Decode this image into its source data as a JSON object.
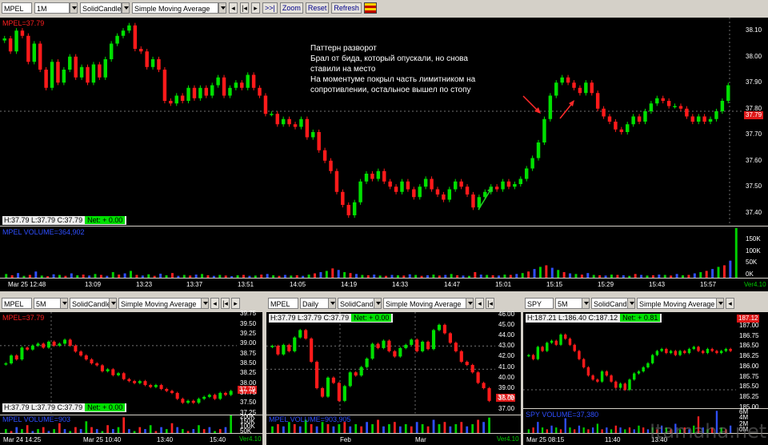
{
  "main": {
    "toolbar": {
      "symbol": "MPEL",
      "interval": "1M",
      "chart_style": "SolidCandle",
      "study": "Simple Moving Average",
      "zoom": "Zoom",
      "reset": "Reset",
      "refresh": "Refresh",
      "nav_left": "◂",
      "nav_home": "|◂",
      "nav_right": "▸",
      "nav_end": ">>|"
    },
    "price_label": "MPEL=37.79",
    "price_tag": "37.79",
    "ohlc": "H:37.79  L:37.79  C:37.79",
    "net": "Net: + 0.00",
    "volume_label": "MPEL VOLUME=364,902",
    "version": "Ver4.10",
    "y_ticks": [
      "38.10",
      "38.00",
      "37.90",
      "37.80",
      "37.70",
      "37.60",
      "37.50",
      "37.40"
    ],
    "vol_ticks": [
      "150K",
      "100K",
      "50K",
      "0K"
    ],
    "x_ticks": [
      "Mar 25 12:48",
      "13:09",
      "13:23",
      "13:37",
      "13:51",
      "14:05",
      "14:19",
      "14:33",
      "14:47",
      "15:01",
      "15:15",
      "15:29",
      "15:43",
      "15:57"
    ],
    "annotation": [
      "Паттерн разворот",
      "Брал от бида, который опускали, но снова",
      "ставили на место",
      "На моментуме покрыл часть лимитником на",
      "сопротивлении, остальное вышел по стопу"
    ]
  },
  "chart_data": [
    {
      "type": "candlestick",
      "name": "MPEL 1M",
      "ylim": [
        37.35,
        38.15
      ],
      "ticks": [
        38.1,
        38.0,
        37.9,
        37.8,
        37.7,
        37.6,
        37.5,
        37.4
      ],
      "closes": [
        38.07,
        38.02,
        38.1,
        38.08,
        37.98,
        38.05,
        37.95,
        37.88,
        37.98,
        37.9,
        37.95,
        38.0,
        37.92,
        37.96,
        37.9,
        37.97,
        37.92,
        37.99,
        38.05,
        38.08,
        38.1,
        38.12,
        38.03,
        38.02,
        37.96,
        37.99,
        37.95,
        37.83,
        37.82,
        37.85,
        37.83,
        37.88,
        37.84,
        37.88,
        37.85,
        37.89,
        37.92,
        37.85,
        37.88,
        37.9,
        37.88,
        37.93,
        37.88,
        37.85,
        37.78,
        37.78,
        37.74,
        37.76,
        37.74,
        37.73,
        37.76,
        37.69,
        37.71,
        37.64,
        37.6,
        37.56,
        37.48,
        37.43,
        37.39,
        37.44,
        37.52,
        37.55,
        37.53,
        37.56,
        37.52,
        37.5,
        37.48,
        37.52,
        37.49,
        37.46,
        37.5,
        37.53,
        37.49,
        37.47,
        37.45,
        37.49,
        37.52,
        37.5,
        37.47,
        37.42,
        37.46,
        37.48,
        37.5,
        37.49,
        37.52,
        37.5,
        37.51,
        37.53,
        37.57,
        37.61,
        37.67,
        37.76,
        37.85,
        37.9,
        37.92,
        37.9,
        37.88,
        37.86,
        37.9,
        37.86,
        37.8,
        37.77,
        37.75,
        37.72,
        37.71,
        37.74,
        37.77,
        37.75,
        37.79,
        37.82,
        37.84,
        37.83,
        37.81,
        37.81,
        37.8,
        37.77,
        37.75,
        37.77,
        37.75,
        37.76,
        37.79,
        37.83,
        37.89
      ],
      "volume": [
        12,
        8,
        15,
        6,
        9,
        20,
        7,
        5,
        11,
        9,
        6,
        14,
        8,
        10,
        7,
        12,
        9,
        6,
        18,
        10,
        14,
        22,
        9,
        7,
        11,
        6,
        13,
        8,
        15,
        6,
        9,
        7,
        10,
        12,
        8,
        6,
        9,
        7,
        5,
        8,
        9,
        6,
        7,
        10,
        12,
        8,
        6,
        9,
        7,
        8,
        6,
        10,
        14,
        18,
        22,
        30,
        25,
        18,
        15,
        12,
        9,
        8,
        10,
        7,
        6,
        9,
        8,
        7,
        11,
        9,
        6,
        8,
        10,
        7,
        9,
        12,
        8,
        7,
        6,
        18,
        10,
        9,
        8,
        7,
        10,
        9,
        12,
        15,
        20,
        28,
        35,
        40,
        32,
        25,
        18,
        14,
        12,
        10,
        15,
        9,
        8,
        7,
        10,
        9,
        8,
        6,
        12,
        9,
        7,
        8,
        10,
        9,
        7,
        12,
        8,
        9,
        14,
        18,
        22,
        28,
        35,
        40,
        55,
        160
      ]
    },
    {
      "type": "candlestick",
      "name": "MPEL 5M",
      "ylim": [
        37.2,
        39.8
      ],
      "ticks": [
        39.75,
        39.5,
        39.25,
        39.0,
        38.75,
        38.5,
        38.25,
        38.0,
        37.75,
        37.5,
        37.25
      ],
      "closes": [
        38.5,
        38.7,
        38.6,
        38.9,
        38.85,
        38.95,
        39.0,
        38.9,
        39.05,
        38.95,
        39.0,
        39.1,
        38.95,
        38.8,
        38.7,
        38.6,
        38.5,
        38.45,
        38.3,
        38.35,
        38.2,
        38.25,
        38.1,
        38.05,
        38.0,
        38.05,
        37.95,
        37.9,
        37.95,
        37.85,
        37.8,
        37.75,
        37.6,
        37.5,
        37.55,
        37.5,
        37.6,
        37.65,
        37.7,
        37.6,
        37.75,
        37.7,
        37.8
      ]
    },
    {
      "type": "candlestick",
      "name": "MPEL Daily",
      "ylim": [
        36.5,
        46.2
      ],
      "ticks": [
        46.0,
        45.0,
        44.0,
        43.0,
        42.0,
        41.0,
        40.0,
        39.0,
        38.0,
        37.0
      ],
      "closes": [
        43.0,
        42.2,
        43.1,
        42.5,
        43.8,
        44.5,
        43.7,
        41.5,
        39.0,
        38.2,
        40.0,
        39.5,
        37.8,
        39.2,
        40.5,
        40.2,
        41.0,
        41.8,
        43.2,
        42.8,
        43.5,
        42.5,
        42.0,
        42.8,
        43.1,
        43.6,
        42.5,
        43.4,
        42.7,
        44.5,
        45.0,
        44.2,
        43.3,
        42.5,
        41.5,
        41.2,
        40.5,
        39.5,
        39.0,
        37.8
      ]
    },
    {
      "type": "candlestick",
      "name": "SPY 5M",
      "ylim": [
        184.9,
        187.25
      ],
      "ticks": [
        187.0,
        186.75,
        186.5,
        186.25,
        186.0,
        185.75,
        185.5,
        185.25,
        185.0
      ],
      "closes": [
        186.2,
        186.1,
        186.4,
        186.3,
        186.5,
        186.55,
        186.45,
        186.7,
        186.6,
        186.45,
        186.3,
        186.1,
        185.9,
        185.7,
        185.6,
        185.55,
        185.8,
        185.7,
        185.55,
        185.4,
        185.5,
        185.35,
        185.6,
        185.75,
        185.8,
        185.9,
        186.0,
        186.2,
        186.3,
        186.35,
        186.25,
        186.3,
        186.2,
        186.3,
        186.25,
        186.35,
        186.4,
        186.3,
        186.25,
        186.35,
        186.3,
        186.25,
        186.3,
        186.35,
        186.3
      ]
    }
  ],
  "sub1": {
    "symbol": "MPEL",
    "interval": "5M",
    "chart_style": "SolidCandle",
    "study": "Simple Moving Average",
    "price_label": "MPEL=37.79",
    "price_tag": "37.79",
    "ohlc": "H:37.79  L:37.79  C:37.79",
    "net": "Net: + 0.00",
    "volume_label": "MPEL VOLUME=903",
    "version": "Ver4.10",
    "y_ticks": [
      "39.75",
      "39.50",
      "39.25",
      "39.00",
      "38.75",
      "38.50",
      "38.25",
      "38.00",
      "37.75",
      "37.50",
      "37.25"
    ],
    "vol_ticks": [
      "200K",
      "150K",
      "100K",
      "50K"
    ],
    "x_ticks": [
      "Mar 24 14:25",
      "Mar 25 10:40",
      "13:40",
      "15:40"
    ]
  },
  "sub2": {
    "symbol": "MPEL",
    "interval": "Daily",
    "chart_style": "SolidCandle",
    "study": "Simple Moving Average",
    "price_label": "",
    "price_tag": "37.79",
    "ohlc": "H:37.79  L:37.79  C:37.79",
    "net": "Net: + 0.00",
    "volume_label": "MPEL VOLUME=903,905",
    "version": "Ver4.10",
    "y_ticks": [
      "46.00",
      "45.00",
      "44.00",
      "43.00",
      "42.00",
      "41.00",
      "40.00",
      "39.00",
      "38.00",
      "37.00"
    ],
    "x_ticks": [
      "Feb",
      "Mar"
    ]
  },
  "sub3": {
    "symbol": "SPY",
    "interval": "5M",
    "chart_style": "SolidCandle",
    "study": "Simple Moving Average",
    "price_label": "",
    "price_tag": "187.12",
    "ohlc": "H:187.21  L:186.40  C:187.12",
    "net": "Net: + 0.81",
    "volume_label": "SPY VOLUME=37,380",
    "version": "Ver4.10",
    "y_ticks": [
      "187.00",
      "186.75",
      "186.50",
      "186.25",
      "186.00",
      "185.75",
      "185.50",
      "185.25",
      "185.00"
    ],
    "vol_ticks": [
      "6M",
      "4M",
      "2M",
      "0M"
    ],
    "x_ticks": [
      "Mar 25 08:15",
      "11:40",
      "13:40"
    ]
  },
  "watermark": "Itamaha.net"
}
